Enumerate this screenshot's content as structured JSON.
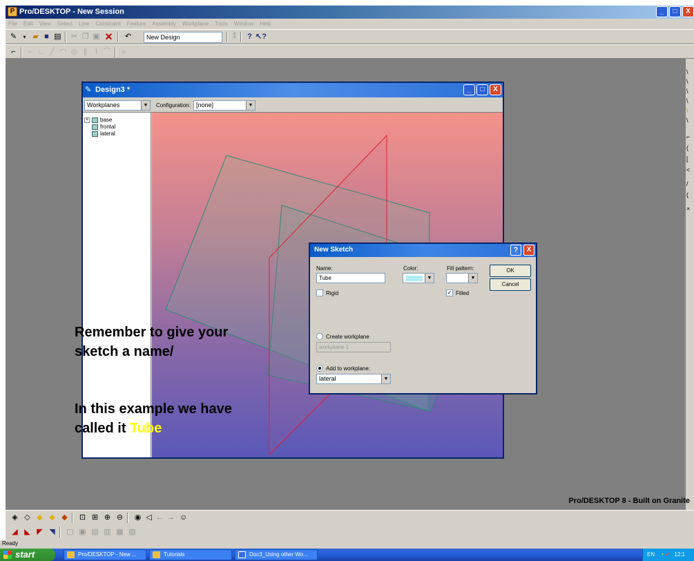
{
  "app": {
    "title": "Pro/DESKTOP - New Session",
    "window_buttons": [
      "_",
      "□",
      "X"
    ]
  },
  "menubar": [
    "File",
    "Edit",
    "View",
    "Select",
    "Line",
    "Constraint",
    "Feature",
    "Assembly",
    "Workplane",
    "Tools",
    "Window",
    "Help"
  ],
  "toolbar": {
    "undo_field": "New Design"
  },
  "design_window": {
    "title": "Design3 *",
    "browser_select": "Workplanes",
    "configuration_label": "Configuration:",
    "configuration_value": "[none]",
    "tree": {
      "expander": "+",
      "items": [
        "base",
        "frontal",
        "lateral"
      ]
    }
  },
  "dialog": {
    "title": "New Sketch",
    "help": "?",
    "close": "X",
    "name_label": "Name:",
    "name_value": "Tube",
    "color_label": "Color:",
    "fill_pattern_label": "Fill pattern:",
    "ok_label": "OK",
    "cancel_label": "Cancel",
    "rigid_label": "Rigid",
    "rigid_checked": false,
    "filled_label": "Filled",
    "filled_checked": true,
    "filled_mark": "✓",
    "create_workplane_label": "Create workplane",
    "create_workplane_value": "workplane 1",
    "add_to_workplane_label": "Add to workplane:",
    "add_to_workplane_value": "lateral",
    "color_value": "#aeeef4"
  },
  "annotation": {
    "line1": "Remember to give your",
    "line2": "sketch a name/",
    "line3": "In this example we have",
    "line4_prefix": "called it ",
    "line4_highlight": "Tube"
  },
  "brand": "Pro/DESKTOP 8 - Built on Granite",
  "status": "Ready",
  "taskbar": {
    "start": "start",
    "items": [
      "Pro/DESKTOP - New ...",
      "Tutorials",
      "Doc3_Using other Wo..."
    ],
    "tray_lang": "EN",
    "clock": "12:1"
  }
}
